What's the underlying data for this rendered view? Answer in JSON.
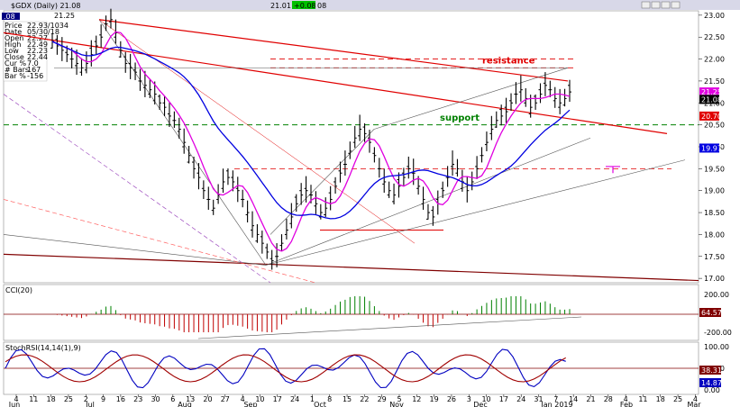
{
  "window": {
    "title": "$GDX (Daily) 21.08",
    "header_last": "21.25",
    "header_mid": "21.01",
    "header_chg": "+0.08",
    "header_chg2": "08",
    "header_left": ".08"
  },
  "info_box": {
    "rows": [
      {
        "label": "Price",
        "value": "22.93/1034"
      },
      {
        "label": "Date",
        "value": "05/30/18"
      },
      {
        "label": "Open",
        "value": "22.27"
      },
      {
        "label": "High",
        "value": "22.49"
      },
      {
        "label": "Low",
        "value": "22.23"
      },
      {
        "label": "Close",
        "value": "22.44"
      },
      {
        "label": "Cur %",
        "value": "7.0"
      },
      {
        "label": "# Bars",
        "value": "167"
      },
      {
        "label": "Bar %",
        "value": "-156"
      }
    ]
  },
  "annotations": {
    "resistance": "resistance",
    "support": "support"
  },
  "panels": {
    "cci": {
      "label": "CCI(20)",
      "value_tag": "64.57",
      "ticks": [
        "200.00",
        "-200.00"
      ]
    },
    "stoch": {
      "label": "StochRSI(14,14(1),9)",
      "value_tag1": "38.31",
      "value_tag2": "14.87",
      "ticks": [
        "100.00",
        "50.00",
        "0.00"
      ]
    }
  },
  "price_tags": {
    "last": "21.08",
    "red": "20.70",
    "blue": "19.97",
    "top": "21.25"
  },
  "colors": {
    "price_bars": "#000000",
    "ma_fast": "#e000e0",
    "ma_slow": "#0000e0",
    "long_trend": "#e00000",
    "support": "#008000",
    "resistance": "#e00000",
    "dark_red": "#800000"
  },
  "chart_data": {
    "type": "bar",
    "title": "",
    "ylim": [
      16.9,
      23.1
    ],
    "y_ticks": [
      "23.00",
      "22.50",
      "22.00",
      "21.50",
      "21.00",
      "20.50",
      "20.00",
      "19.50",
      "19.00",
      "18.50",
      "18.00",
      "17.50",
      "17.00"
    ],
    "x_ticks": [
      "4",
      "11",
      "18",
      "25",
      "2",
      "9",
      "16",
      "23",
      "30",
      "6",
      "13",
      "20",
      "27",
      "4",
      "10",
      "17",
      "24",
      "1",
      "8",
      "15",
      "22",
      "29",
      "5",
      "12",
      "19",
      "26",
      "3",
      "10",
      "17",
      "24",
      "31",
      "7",
      "14",
      "21",
      "28",
      "4",
      "11",
      "18",
      "25",
      "4"
    ],
    "month_labels": [
      "Jun",
      "Jul",
      "Aug",
      "Sep",
      "Oct",
      "Nov",
      "Dec",
      "Jan 2019",
      "Feb",
      "Mar"
    ],
    "ohlc_close": [
      22.4,
      22.3,
      22.2,
      22.1,
      22.0,
      21.9,
      21.8,
      21.9,
      22.1,
      22.3,
      22.5,
      22.8,
      22.9,
      22.6,
      22.2,
      21.9,
      21.8,
      21.7,
      21.5,
      21.4,
      21.3,
      21.2,
      21.0,
      20.9,
      20.7,
      20.6,
      20.4,
      20.1,
      19.8,
      19.5,
      19.3,
      19.0,
      18.8,
      18.6,
      18.9,
      19.2,
      19.3,
      19.2,
      19.0,
      18.8,
      18.5,
      18.2,
      18.0,
      17.8,
      17.6,
      17.4,
      17.5,
      17.8,
      18.1,
      18.4,
      18.7,
      18.9,
      19.0,
      18.9,
      18.7,
      18.5,
      18.6,
      18.8,
      19.1,
      19.4,
      19.6,
      19.9,
      20.2,
      20.4,
      20.3,
      20.1,
      19.8,
      19.5,
      19.2,
      19.0,
      18.9,
      19.1,
      19.3,
      19.5,
      19.4,
      19.1,
      18.8,
      18.5,
      18.4,
      18.7,
      19.0,
      19.3,
      19.6,
      19.5,
      19.2,
      19.0,
      19.2,
      19.5,
      19.8,
      20.1,
      20.4,
      20.6,
      20.7,
      20.8,
      21.0,
      21.2,
      21.3,
      21.1,
      20.9,
      21.0,
      21.2,
      21.4,
      21.3,
      21.1,
      21.0,
      21.1,
      21.25
    ]
  }
}
